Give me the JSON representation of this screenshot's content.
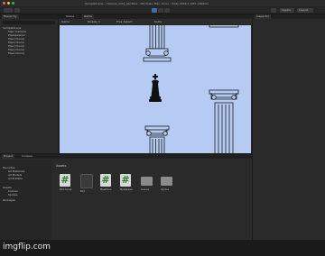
{
  "window": {
    "title": "SampleScene - claviusz_unity_sandbox - Windows, Mac, Linux - Unity 2022.3.19f1 <Metal>",
    "traffic_lights": [
      "#ff5f57",
      "#febc2e",
      "#28c840"
    ]
  },
  "toolbar": {
    "right_items": [
      "Layers",
      "Layout"
    ]
  },
  "hierarchy": {
    "tab": "Hierarchy",
    "items": [
      "SampleScene",
      "Main Camera",
      "Pipespawner",
      "Pipe (Clone)",
      "Pipe (Clone)",
      "Pipe (Clone)",
      "Pipe (Clone)",
      "Pipe (Clone)"
    ]
  },
  "center": {
    "tabs": [
      "Scene",
      "Game"
    ],
    "game_bar": [
      "Game",
      "Display 1",
      "Free Aspect",
      "Scale"
    ]
  },
  "inspector": {
    "tab": "Inspector"
  },
  "project": {
    "tabs": [
      "Project",
      "Console"
    ],
    "sidebar": [
      "Favorites",
      "All Materials",
      "All Models",
      "All Prefabs",
      "Assets",
      "Scenes",
      "Sprites",
      "Packages"
    ],
    "breadcrumb": "Assets",
    "items": [
      {
        "name": "Bird Script",
        "icon": "csharp-script-icon"
      },
      {
        "name": "Bird",
        "icon": "prefab-icon"
      },
      {
        "name": "PipeMove",
        "icon": "csharp-script-icon"
      },
      {
        "name": "PipeSpawn",
        "icon": "csharp-script-icon"
      },
      {
        "name": "Scenes",
        "icon": "folder-icon"
      },
      {
        "name": "Sprites",
        "icon": "folder-icon"
      }
    ]
  },
  "watermark": "imgflip.com",
  "colors": {
    "sky": "#b5cbf4",
    "accent": "#3f6ea8"
  }
}
